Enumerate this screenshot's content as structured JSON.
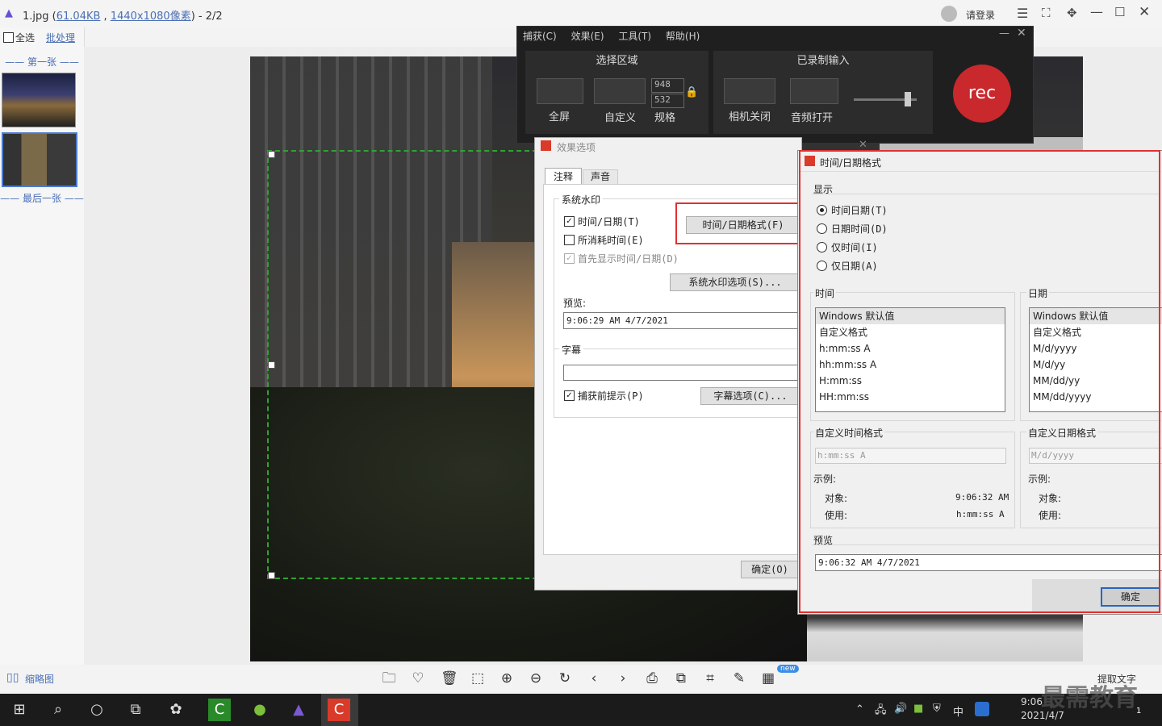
{
  "viewer": {
    "filename": "1.jpg",
    "size": "61.04KB",
    "dimensions": "1440x1080像素",
    "counter": "- 2/2",
    "login": "请登录",
    "select_all": "全选",
    "batch": "批处理",
    "first": "第一张",
    "last": "最后一张",
    "thumbnail_label": "缩略图",
    "extract_text": "提取文字",
    "new_badge": "new"
  },
  "recorder": {
    "menu": [
      "捕获(C)",
      "效果(E)",
      "工具(T)",
      "帮助(H)"
    ],
    "group_select": "选择区域",
    "group_input": "已录制输入",
    "fullscreen": "全屏",
    "custom": "自定义",
    "spec": "规格",
    "width": "948",
    "height": "532",
    "camera": "相机关闭",
    "audio": "音频打开",
    "rec": "rec"
  },
  "effects": {
    "title": "效果选项",
    "tab_note": "注释",
    "tab_sound": "声音",
    "group_watermark": "系统水印",
    "cb_time": "时间/日期(T)",
    "cb_elapsed": "所消耗时间(E)",
    "cb_first": "首先显示时间/日期(D)",
    "btn_timefmt": "时间/日期格式(F)",
    "btn_wm_options": "系统水印选项(S)...",
    "preview_label": "预览:",
    "preview_value": "9:06:29 AM 4/7/2021",
    "group_caption": "字幕",
    "cb_prompt": "捕获前提示(P)",
    "btn_caption_options": "字幕选项(C)...",
    "ok": "确定(O)"
  },
  "timefmt": {
    "title": "时间/日期格式",
    "group_display": "显示",
    "radios": [
      "时间日期(T)",
      "日期时间(D)",
      "仅时间(I)",
      "仅日期(A)"
    ],
    "group_time": "时间",
    "group_date": "日期",
    "time_list": [
      "Windows 默认值",
      "自定义格式",
      "h:mm:ss A",
      "hh:mm:ss A",
      "H:mm:ss",
      "HH:mm:ss"
    ],
    "date_list": [
      "Windows 默认值",
      "自定义格式",
      "M/d/yyyy",
      "M/d/yy",
      "MM/dd/yy",
      "MM/dd/yyyy"
    ],
    "custom_time": "自定义时间格式",
    "custom_date": "自定义日期格式",
    "custom_time_value": "h:mm:ss A",
    "custom_date_value": "M/d/yyyy",
    "example": "示例:",
    "object": "对象:",
    "use": "使用:",
    "object_time": "9:06:32 AM",
    "use_time": "h:mm:ss A",
    "preview_label": "预览",
    "preview_value": "9:06:32 AM 4/7/2021",
    "ok": "确定"
  },
  "taskbar": {
    "clock_time": "9:06",
    "clock_date": "2021/4/7",
    "ime": "中",
    "watermark": "最需教育",
    "notif_count": "1"
  },
  "colors": {
    "accent_red": "#e23030",
    "rec_red": "#c9282d",
    "selection_green": "#2ea42e"
  }
}
